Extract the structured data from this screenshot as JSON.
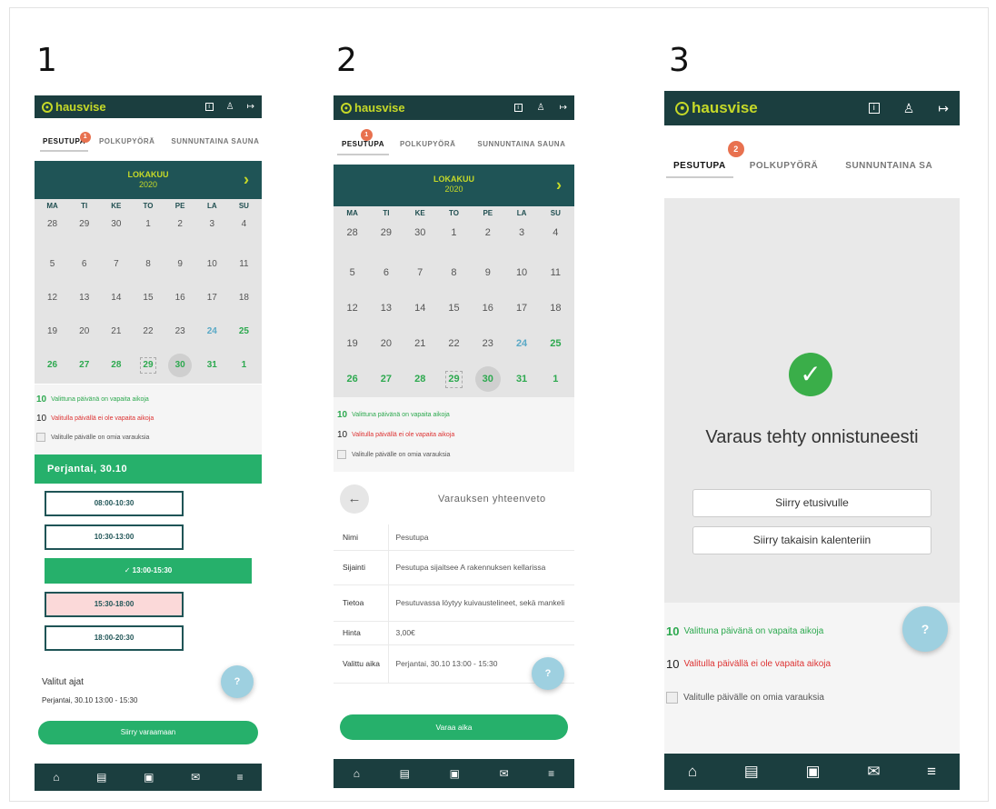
{
  "steps": [
    "1",
    "2",
    "3"
  ],
  "app": {
    "logo_text": "hausvise",
    "icons": {
      "info": "info-icon",
      "user": "user-icon",
      "logout": "logout-icon"
    }
  },
  "tabs": [
    "PESUTUPA",
    "POLKUPYÖRÄ",
    "SUNNUNTAINA SAUNA"
  ],
  "tab3_truncated": "SUNNUNTAINA SA",
  "badges": [
    "1",
    "1",
    "2"
  ],
  "calendar": {
    "month": "LOKAKUU",
    "year": "2020",
    "next_icon": "chevron-right-icon",
    "day_headers": [
      "MA",
      "TI",
      "KE",
      "TO",
      "PE",
      "LA",
      "SU"
    ],
    "weeks": [
      [
        "28",
        "29",
        "30",
        "1",
        "2",
        "3",
        "4"
      ],
      [
        "5",
        "6",
        "7",
        "8",
        "9",
        "10",
        "11"
      ],
      [
        "12",
        "13",
        "14",
        "15",
        "16",
        "17",
        "18"
      ],
      [
        "19",
        "20",
        "21",
        "22",
        "23",
        "24",
        "25"
      ],
      [
        "26",
        "27",
        "28",
        "29",
        "30",
        "31",
        "1"
      ]
    ]
  },
  "legend": {
    "green_num": "10",
    "green_text": "Valittuna päivänä on vapaita aikoja",
    "red_num": "10",
    "red_text": "Valitulla päivällä ei ole vapaita aikoja",
    "grey_text": "Valitulle päivälle on omia varauksia"
  },
  "screen1": {
    "day_label": "Perjantai, 30.10",
    "slots": [
      "08:00-10:30",
      "10:30-13:00",
      "✓ 13:00-15:30",
      "15:30-18:00",
      "18:00-20:30"
    ],
    "selected_title": "Valitut ajat",
    "selected_value": "Perjantai, 30.10 13:00 - 15:30",
    "cta": "Siirry varaamaan"
  },
  "screen2": {
    "back_icon": "arrow-left-icon",
    "summary_title": "Varauksen yhteenveto",
    "rows": [
      {
        "k": "Nimi",
        "v": "Pesutupa"
      },
      {
        "k": "Sijainti",
        "v": "Pesutupa sijaitsee A rakennuksen kellarissa"
      },
      {
        "k": "Tietoa",
        "v": "Pesutuvassa löytyy kuivaustelineet, sekä mankeli"
      },
      {
        "k": "Hinta",
        "v": "3,00€"
      },
      {
        "k": "Valittu aika",
        "v": "Perjantai, 30.10 13:00 - 15:30"
      }
    ],
    "cta": "Varaa aika"
  },
  "screen3": {
    "success_icon": "check-circle-icon",
    "success_text": "Varaus tehty onnistuneesti",
    "btn_home": "Siirry etusivulle",
    "btn_back": "Siirry takaisin kalenteriin"
  },
  "help_fab": {
    "icon": "help-icon",
    "glyph": "?"
  },
  "bottom_nav": [
    "home-icon",
    "news-icon",
    "contact-card-icon",
    "mail-icon",
    "menu-icon"
  ]
}
